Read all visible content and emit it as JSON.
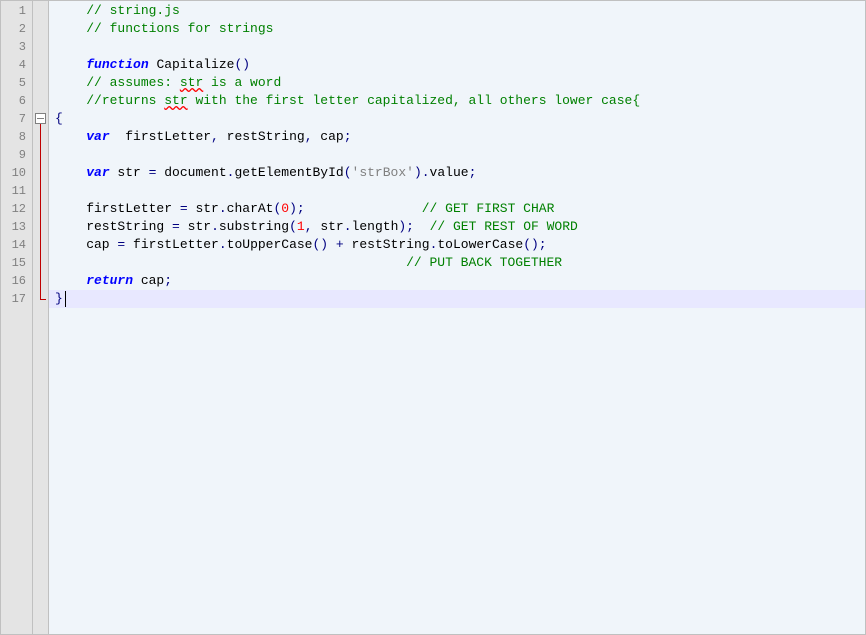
{
  "editor": {
    "line_count": 17,
    "highlighted_line": 17,
    "fold_start_line": 7,
    "fold_end_line": 17,
    "lines": [
      {
        "n": 1,
        "tokens": [
          {
            "t": "    ",
            "c": "plain"
          },
          {
            "t": "// string.js",
            "c": "comment"
          }
        ]
      },
      {
        "n": 2,
        "tokens": [
          {
            "t": "    ",
            "c": "plain"
          },
          {
            "t": "// functions for strings",
            "c": "comment"
          }
        ]
      },
      {
        "n": 3,
        "tokens": []
      },
      {
        "n": 4,
        "tokens": [
          {
            "t": "    ",
            "c": "plain"
          },
          {
            "t": "function",
            "c": "keyword"
          },
          {
            "t": " Capitalize",
            "c": "plain"
          },
          {
            "t": "()",
            "c": "punc"
          }
        ]
      },
      {
        "n": 5,
        "tokens": [
          {
            "t": "    ",
            "c": "plain"
          },
          {
            "t": "// assumes: ",
            "c": "comment"
          },
          {
            "t": "str",
            "c": "comment",
            "sq": true
          },
          {
            "t": " is a word",
            "c": "comment"
          }
        ]
      },
      {
        "n": 6,
        "tokens": [
          {
            "t": "    ",
            "c": "plain"
          },
          {
            "t": "//returns ",
            "c": "comment"
          },
          {
            "t": "str",
            "c": "comment",
            "sq": true
          },
          {
            "t": " with the first letter capitalized, all others lower case{",
            "c": "comment"
          }
        ]
      },
      {
        "n": 7,
        "tokens": [
          {
            "t": "{",
            "c": "punc"
          }
        ]
      },
      {
        "n": 8,
        "tokens": [
          {
            "t": "    ",
            "c": "plain"
          },
          {
            "t": "var",
            "c": "keyword"
          },
          {
            "t": "  firstLetter",
            "c": "plain"
          },
          {
            "t": ",",
            "c": "punc"
          },
          {
            "t": " restString",
            "c": "plain"
          },
          {
            "t": ",",
            "c": "punc"
          },
          {
            "t": " cap",
            "c": "plain"
          },
          {
            "t": ";",
            "c": "punc"
          }
        ]
      },
      {
        "n": 9,
        "tokens": []
      },
      {
        "n": 10,
        "tokens": [
          {
            "t": "    ",
            "c": "plain"
          },
          {
            "t": "var",
            "c": "keyword"
          },
          {
            "t": " str ",
            "c": "plain"
          },
          {
            "t": "=",
            "c": "punc"
          },
          {
            "t": " document",
            "c": "plain"
          },
          {
            "t": ".",
            "c": "punc"
          },
          {
            "t": "getElementById",
            "c": "plain"
          },
          {
            "t": "(",
            "c": "punc"
          },
          {
            "t": "'strBox'",
            "c": "string"
          },
          {
            "t": ").",
            "c": "punc"
          },
          {
            "t": "value",
            "c": "plain"
          },
          {
            "t": ";",
            "c": "punc"
          }
        ]
      },
      {
        "n": 11,
        "tokens": []
      },
      {
        "n": 12,
        "tokens": [
          {
            "t": "    firstLetter ",
            "c": "plain"
          },
          {
            "t": "=",
            "c": "punc"
          },
          {
            "t": " str",
            "c": "plain"
          },
          {
            "t": ".",
            "c": "punc"
          },
          {
            "t": "charAt",
            "c": "plain"
          },
          {
            "t": "(",
            "c": "punc"
          },
          {
            "t": "0",
            "c": "number"
          },
          {
            "t": ");",
            "c": "punc"
          },
          {
            "t": "               ",
            "c": "plain"
          },
          {
            "t": "// GET FIRST CHAR",
            "c": "comment"
          }
        ]
      },
      {
        "n": 13,
        "tokens": [
          {
            "t": "    restString ",
            "c": "plain"
          },
          {
            "t": "=",
            "c": "punc"
          },
          {
            "t": " str",
            "c": "plain"
          },
          {
            "t": ".",
            "c": "punc"
          },
          {
            "t": "substring",
            "c": "plain"
          },
          {
            "t": "(",
            "c": "punc"
          },
          {
            "t": "1",
            "c": "number"
          },
          {
            "t": ",",
            "c": "punc"
          },
          {
            "t": " str",
            "c": "plain"
          },
          {
            "t": ".",
            "c": "punc"
          },
          {
            "t": "length",
            "c": "plain"
          },
          {
            "t": ");",
            "c": "punc"
          },
          {
            "t": "  ",
            "c": "plain"
          },
          {
            "t": "// GET REST OF WORD",
            "c": "comment"
          }
        ]
      },
      {
        "n": 14,
        "tokens": [
          {
            "t": "    cap ",
            "c": "plain"
          },
          {
            "t": "=",
            "c": "punc"
          },
          {
            "t": " firstLetter",
            "c": "plain"
          },
          {
            "t": ".",
            "c": "punc"
          },
          {
            "t": "toUpperCase",
            "c": "plain"
          },
          {
            "t": "()",
            "c": "punc"
          },
          {
            "t": " ",
            "c": "plain"
          },
          {
            "t": "+",
            "c": "punc"
          },
          {
            "t": " restString",
            "c": "plain"
          },
          {
            "t": ".",
            "c": "punc"
          },
          {
            "t": "toLowerCase",
            "c": "plain"
          },
          {
            "t": "();",
            "c": "punc"
          }
        ]
      },
      {
        "n": 15,
        "tokens": [
          {
            "t": "                                             ",
            "c": "plain"
          },
          {
            "t": "// PUT BACK TOGETHER",
            "c": "comment"
          }
        ]
      },
      {
        "n": 16,
        "tokens": [
          {
            "t": "    ",
            "c": "plain"
          },
          {
            "t": "return",
            "c": "keyword"
          },
          {
            "t": " cap",
            "c": "plain"
          },
          {
            "t": ";",
            "c": "punc"
          }
        ]
      },
      {
        "n": 17,
        "tokens": [
          {
            "t": "}",
            "c": "punc"
          }
        ]
      }
    ]
  }
}
